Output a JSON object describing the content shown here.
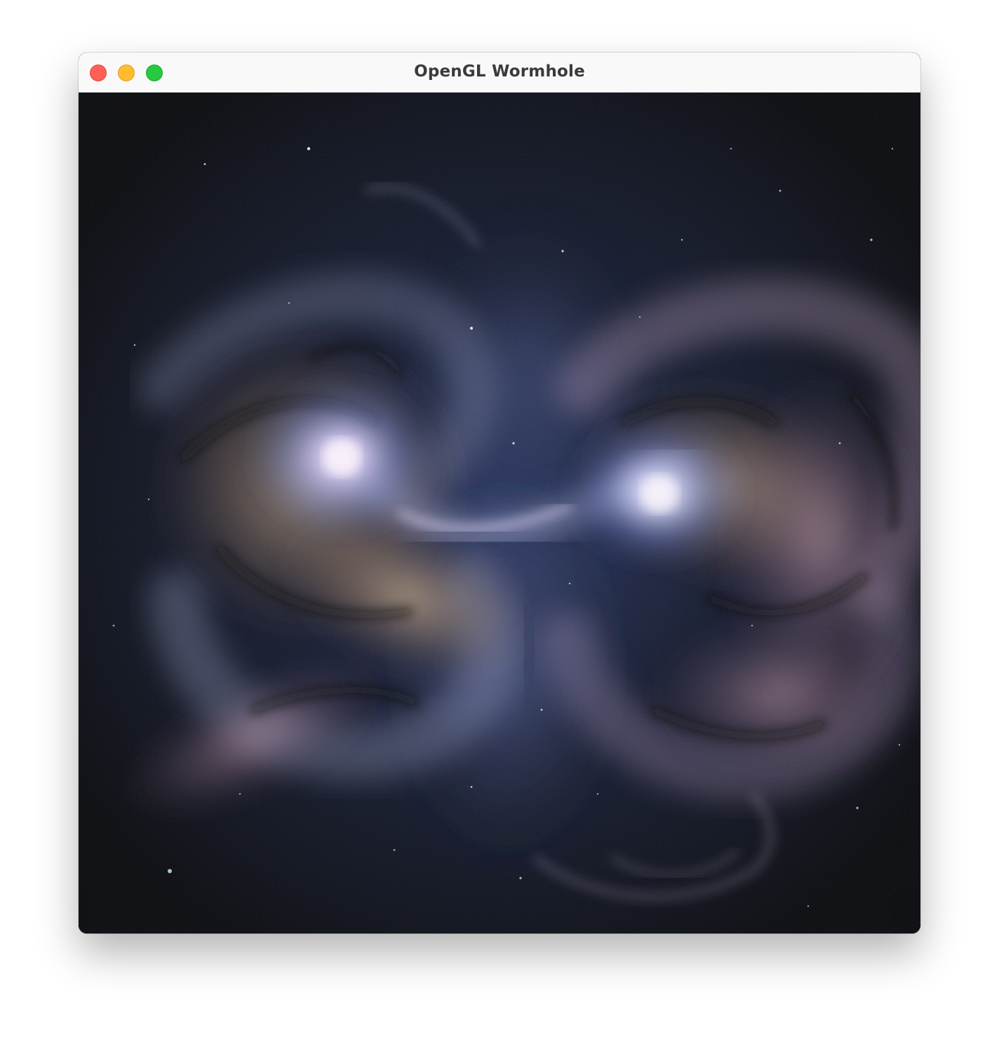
{
  "window": {
    "title": "OpenGL Wormhole"
  },
  "traffic_lights": {
    "close": "close-icon",
    "minimize": "minimize-icon",
    "zoom": "zoom-icon",
    "colors": {
      "close": "#fe5f57",
      "minimize": "#febc2e",
      "zoom": "#28c840"
    }
  },
  "scene": {
    "description_icon": "galaxy-render",
    "colors": {
      "space": "#05060b",
      "nebula_blue": "#4a5a9a",
      "core_glow": "#e8dcff",
      "dust_gold": "#c8a070",
      "dust_pink": "#d9a8b8"
    }
  }
}
